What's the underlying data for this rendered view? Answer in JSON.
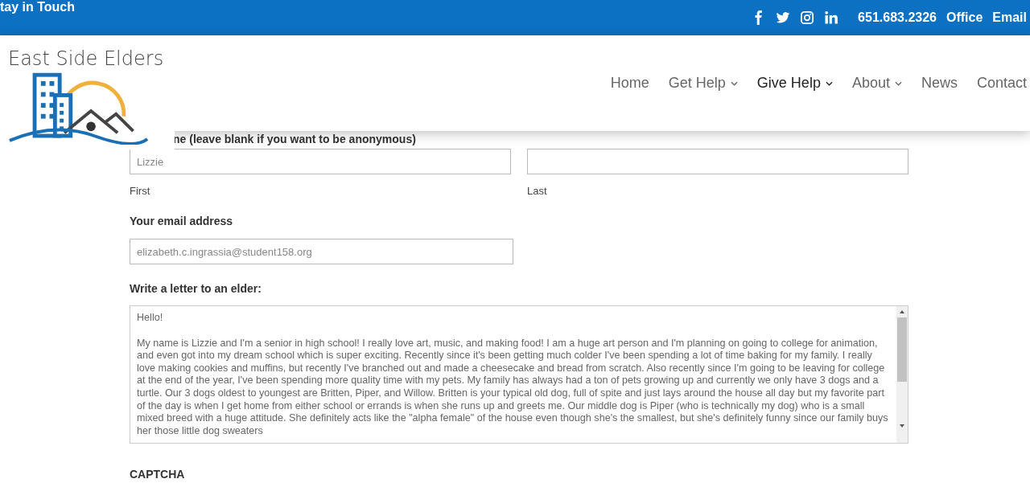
{
  "top_bar": {
    "tagline": "tay in Touch",
    "social": [
      {
        "kind": "facebook"
      },
      {
        "kind": "twitter"
      },
      {
        "kind": "instagram"
      },
      {
        "kind": "linkedin"
      }
    ],
    "links": [
      "651.683.2326",
      "Office",
      "Email"
    ]
  },
  "header": {
    "logo_text": "East Side Elders",
    "nav": [
      {
        "label": "Home",
        "selected": false,
        "dropdown": false
      },
      {
        "label": "Get Help",
        "selected": false,
        "dropdown": true
      },
      {
        "label": "Give Help",
        "selected": true,
        "dropdown": true
      },
      {
        "label": "About",
        "selected": false,
        "dropdown": true
      },
      {
        "label": "News",
        "selected": false,
        "dropdown": false
      },
      {
        "label": "Contact",
        "selected": false,
        "dropdown": false
      }
    ]
  },
  "form": {
    "name_label": "ne (leave blank if you want to be anonymous)",
    "first": {
      "value": "Lizzie",
      "caption": "First"
    },
    "last": {
      "caption": "Last"
    },
    "email_label": "Your email address",
    "email_value": "elizabeth.c.ingrassia@student158.org",
    "letter_label": "Write a letter to an elder:",
    "letter_paragraphs": [
      "Hello!",
      "My name is Lizzie and I'm a senior in high school! I really love art, music, and making food! I am a huge art person and I'm planning on going to college for animation, and even got into my dream school which is super exciting. Recently since it's been getting much colder I've been spending a lot of time baking for my family. I really love making cookies and muffins, but recently I've branched out and made a cheesecake and bread from scratch. Also recently since I'm going to be leaving for college at the end of the year, I've been spending more quality time with my pets. My family has always had a ton of pets growing up and currently we only have 3 dogs and a turtle. Our 3 dogs oldest to youngest are Britten, Piper, and Willow. Britten is your typical old dog, full of spite and just lays around the house all day but my favorite part of the day is when I get home from either school or errands is when she runs up and greets me. Our middle dog is Piper (who is technically my dog) who is a small mixed breed with a huge attitude. She definitely acts like the \"alpha female\" of the house even though she's the smallest, but she's definitely funny since our family buys her those little dog sweaters"
    ],
    "captcha_label": "CAPTCHA"
  }
}
